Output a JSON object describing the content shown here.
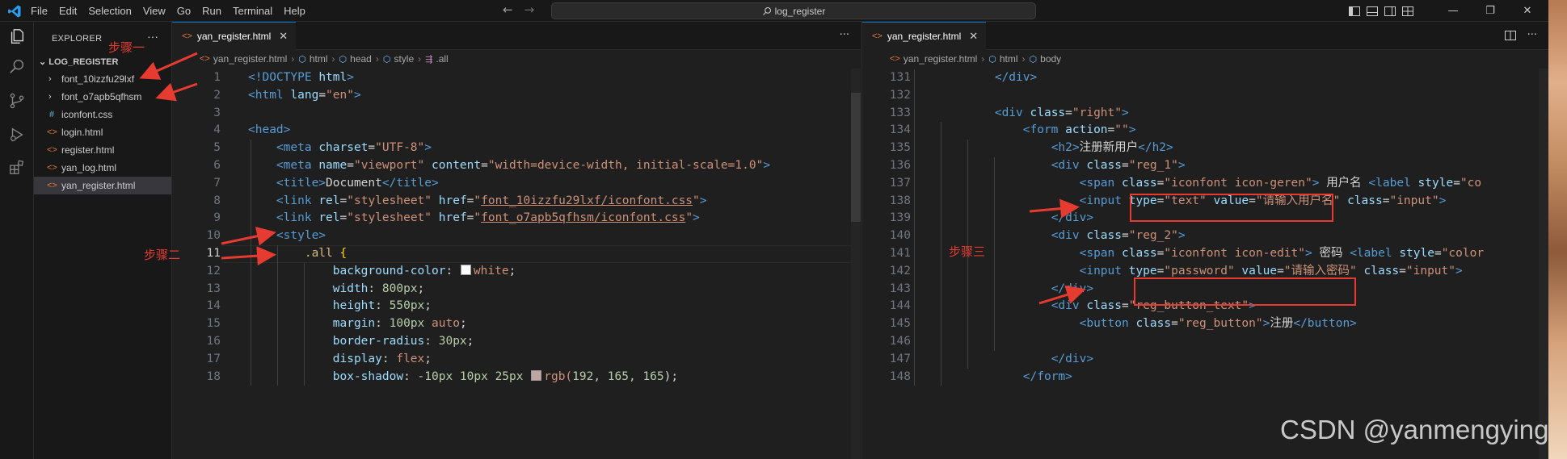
{
  "titlebar": {
    "menu": [
      "File",
      "Edit",
      "Selection",
      "View",
      "Go",
      "Run",
      "Terminal",
      "Help"
    ],
    "search_text": "log_register"
  },
  "explorer": {
    "title": "EXPLORER",
    "folder": "LOG_REGISTER",
    "items": [
      {
        "label": "font_10izzfu29lxf",
        "type": "folder"
      },
      {
        "label": "font_o7apb5qfhsm",
        "type": "folder"
      },
      {
        "label": "iconfont.css",
        "type": "css"
      },
      {
        "label": "login.html",
        "type": "html"
      },
      {
        "label": "register.html",
        "type": "html"
      },
      {
        "label": "yan_log.html",
        "type": "html"
      },
      {
        "label": "yan_register.html",
        "type": "html"
      }
    ]
  },
  "left_editor": {
    "tab_label": "yan_register.html",
    "breadcrumbs": [
      "yan_register.html",
      "html",
      "head",
      "style",
      ".all"
    ],
    "active_line": "11",
    "lines": [
      {
        "n": "1",
        "segs": [
          [
            "<!DOCTYPE ",
            "t-tag"
          ],
          [
            "html",
            "t-attr"
          ],
          [
            ">",
            "t-tag"
          ]
        ]
      },
      {
        "n": "2",
        "segs": [
          [
            "<html ",
            "t-tag"
          ],
          [
            "lang",
            "t-attr"
          ],
          [
            "=",
            ""
          ],
          [
            "\"en\"",
            "t-str"
          ],
          [
            ">",
            "t-tag"
          ]
        ]
      },
      {
        "n": "3",
        "segs": []
      },
      {
        "n": "4",
        "segs": [
          [
            "<head>",
            "t-tag"
          ]
        ]
      },
      {
        "n": "5",
        "segs": [
          [
            "    ",
            ""
          ],
          [
            "<meta ",
            "t-tag"
          ],
          [
            "charset",
            "t-attr"
          ],
          [
            "=",
            ""
          ],
          [
            "\"UTF-8\"",
            "t-str"
          ],
          [
            ">",
            "t-tag"
          ]
        ]
      },
      {
        "n": "6",
        "segs": [
          [
            "    ",
            ""
          ],
          [
            "<meta ",
            "t-tag"
          ],
          [
            "name",
            "t-attr"
          ],
          [
            "=",
            ""
          ],
          [
            "\"viewport\" ",
            "t-str"
          ],
          [
            "content",
            "t-attr"
          ],
          [
            "=",
            ""
          ],
          [
            "\"width=device-width, initial-scale=1.0\"",
            "t-str"
          ],
          [
            ">",
            "t-tag"
          ]
        ]
      },
      {
        "n": "7",
        "segs": [
          [
            "    ",
            ""
          ],
          [
            "<title>",
            "t-tag"
          ],
          [
            "Document",
            ""
          ],
          [
            "</title>",
            "t-tag"
          ]
        ]
      },
      {
        "n": "8",
        "segs": [
          [
            "    ",
            ""
          ],
          [
            "<link ",
            "t-tag"
          ],
          [
            "rel",
            "t-attr"
          ],
          [
            "=",
            ""
          ],
          [
            "\"stylesheet\" ",
            "t-str"
          ],
          [
            "href",
            "t-attr"
          ],
          [
            "=",
            ""
          ],
          [
            "\"",
            "t-str"
          ],
          [
            "font_10izzfu29lxf/iconfont.css",
            "t-link"
          ],
          [
            "\"",
            "t-str"
          ],
          [
            ">",
            "t-tag"
          ]
        ]
      },
      {
        "n": "9",
        "segs": [
          [
            "    ",
            ""
          ],
          [
            "<link ",
            "t-tag"
          ],
          [
            "rel",
            "t-attr"
          ],
          [
            "=",
            ""
          ],
          [
            "\"stylesheet\" ",
            "t-str"
          ],
          [
            "href",
            "t-attr"
          ],
          [
            "=",
            ""
          ],
          [
            "\"",
            "t-str"
          ],
          [
            "font_o7apb5qfhsm/iconfont.css",
            "t-link"
          ],
          [
            "\"",
            "t-str"
          ],
          [
            ">",
            "t-tag"
          ]
        ]
      },
      {
        "n": "10",
        "segs": [
          [
            "    ",
            ""
          ],
          [
            "<style>",
            "t-tag"
          ]
        ]
      },
      {
        "n": "11",
        "segs": [
          [
            "        ",
            ""
          ],
          [
            ".all ",
            "t-sel"
          ],
          [
            "{",
            "t-brace"
          ]
        ]
      },
      {
        "n": "12",
        "segs": [
          [
            "            ",
            ""
          ],
          [
            "background-color",
            "t-prop"
          ],
          [
            ": ",
            ""
          ],
          [
            "#SWATCH#ffffff",
            "swatch"
          ],
          [
            "white",
            "t-val"
          ],
          [
            ";",
            ""
          ]
        ]
      },
      {
        "n": "13",
        "segs": [
          [
            "            ",
            ""
          ],
          [
            "width",
            "t-prop"
          ],
          [
            ": ",
            ""
          ],
          [
            "800px",
            "t-num"
          ],
          [
            ";",
            ""
          ]
        ]
      },
      {
        "n": "14",
        "segs": [
          [
            "            ",
            ""
          ],
          [
            "height",
            "t-prop"
          ],
          [
            ": ",
            ""
          ],
          [
            "550px",
            "t-num"
          ],
          [
            ";",
            ""
          ]
        ]
      },
      {
        "n": "15",
        "segs": [
          [
            "            ",
            ""
          ],
          [
            "margin",
            "t-prop"
          ],
          [
            ": ",
            ""
          ],
          [
            "100px",
            "t-num"
          ],
          [
            " auto",
            "t-val"
          ],
          [
            ";",
            ""
          ]
        ]
      },
      {
        "n": "16",
        "segs": [
          [
            "            ",
            ""
          ],
          [
            "border-radius",
            "t-prop"
          ],
          [
            ": ",
            ""
          ],
          [
            "30px",
            "t-num"
          ],
          [
            ";",
            ""
          ]
        ]
      },
      {
        "n": "17",
        "segs": [
          [
            "            ",
            ""
          ],
          [
            "display",
            "t-prop"
          ],
          [
            ": ",
            ""
          ],
          [
            "flex",
            "t-val"
          ],
          [
            ";",
            ""
          ]
        ]
      },
      {
        "n": "18",
        "segs": [
          [
            "            ",
            ""
          ],
          [
            "box-shadow",
            "t-prop"
          ],
          [
            ": ",
            ""
          ],
          [
            "-10px 10px 25px ",
            "t-num"
          ],
          [
            "#SWATCH#c0a5a5",
            "swatch"
          ],
          [
            "rgb(",
            "t-val"
          ],
          [
            "192, 165, 165",
            "t-num"
          ],
          [
            ");",
            ""
          ]
        ]
      }
    ]
  },
  "right_editor": {
    "tab_label": "yan_register.html",
    "breadcrumbs": [
      "yan_register.html",
      "html",
      "body"
    ],
    "lines": [
      {
        "n": "131",
        "segs": [
          [
            "        ",
            ""
          ],
          [
            "</div>",
            "t-tag"
          ]
        ]
      },
      {
        "n": "132",
        "segs": []
      },
      {
        "n": "133",
        "segs": [
          [
            "        ",
            ""
          ],
          [
            "<div ",
            "t-tag"
          ],
          [
            "class",
            "t-attr"
          ],
          [
            "=",
            ""
          ],
          [
            "\"right\"",
            "t-str"
          ],
          [
            ">",
            "t-tag"
          ]
        ]
      },
      {
        "n": "134",
        "segs": [
          [
            "            ",
            ""
          ],
          [
            "<form ",
            "t-tag"
          ],
          [
            "action",
            "t-attr"
          ],
          [
            "=",
            ""
          ],
          [
            "\"\"",
            "t-str"
          ],
          [
            ">",
            "t-tag"
          ]
        ]
      },
      {
        "n": "135",
        "segs": [
          [
            "                ",
            ""
          ],
          [
            "<h2>",
            "t-tag"
          ],
          [
            "注册新用户",
            ""
          ],
          [
            "</h2>",
            "t-tag"
          ]
        ]
      },
      {
        "n": "136",
        "segs": [
          [
            "                ",
            ""
          ],
          [
            "<div ",
            "t-tag"
          ],
          [
            "class",
            "t-attr"
          ],
          [
            "=",
            ""
          ],
          [
            "\"reg_1\"",
            "t-str"
          ],
          [
            ">",
            "t-tag"
          ]
        ]
      },
      {
        "n": "137",
        "segs": [
          [
            "                    ",
            ""
          ],
          [
            "<span ",
            "t-tag"
          ],
          [
            "class",
            "t-attr"
          ],
          [
            "=",
            ""
          ],
          [
            "\"iconfont icon-geren\"",
            "t-str"
          ],
          [
            "> ",
            "t-tag"
          ],
          [
            "用户名 ",
            ""
          ],
          [
            "<label ",
            "t-tag"
          ],
          [
            "style",
            "t-attr"
          ],
          [
            "=",
            ""
          ],
          [
            "\"co",
            "t-str"
          ]
        ]
      },
      {
        "n": "138",
        "segs": [
          [
            "                    ",
            ""
          ],
          [
            "<input ",
            "t-tag"
          ],
          [
            "type",
            "t-attr"
          ],
          [
            "=",
            ""
          ],
          [
            "\"text\" ",
            "t-str"
          ],
          [
            "value",
            "t-attr"
          ],
          [
            "=",
            ""
          ],
          [
            "\"请输入用户名\" ",
            "t-str"
          ],
          [
            "class",
            "t-attr"
          ],
          [
            "=",
            ""
          ],
          [
            "\"input\"",
            "t-str"
          ],
          [
            ">",
            "t-tag"
          ]
        ]
      },
      {
        "n": "139",
        "segs": [
          [
            "                ",
            ""
          ],
          [
            "</div>",
            "t-tag"
          ]
        ]
      },
      {
        "n": "140",
        "segs": [
          [
            "                ",
            ""
          ],
          [
            "<div ",
            "t-tag"
          ],
          [
            "class",
            "t-attr"
          ],
          [
            "=",
            ""
          ],
          [
            "\"reg_2\"",
            "t-str"
          ],
          [
            ">",
            "t-tag"
          ]
        ]
      },
      {
        "n": "141",
        "segs": [
          [
            "                    ",
            ""
          ],
          [
            "<span ",
            "t-tag"
          ],
          [
            "class",
            "t-attr"
          ],
          [
            "=",
            ""
          ],
          [
            "\"iconfont icon-edit\"",
            "t-str"
          ],
          [
            "> ",
            "t-tag"
          ],
          [
            "密码 ",
            ""
          ],
          [
            "<label ",
            "t-tag"
          ],
          [
            "style",
            "t-attr"
          ],
          [
            "=",
            ""
          ],
          [
            "\"color",
            "t-str"
          ]
        ]
      },
      {
        "n": "142",
        "segs": [
          [
            "                    ",
            ""
          ],
          [
            "<input ",
            "t-tag"
          ],
          [
            "type",
            "t-attr"
          ],
          [
            "=",
            ""
          ],
          [
            "\"password\" ",
            "t-str"
          ],
          [
            "value",
            "t-attr"
          ],
          [
            "=",
            ""
          ],
          [
            "\"请输入密码\" ",
            "t-str"
          ],
          [
            "class",
            "t-attr"
          ],
          [
            "=",
            ""
          ],
          [
            "\"input\"",
            "t-str"
          ],
          [
            ">",
            "t-tag"
          ]
        ]
      },
      {
        "n": "143",
        "segs": [
          [
            "                ",
            ""
          ],
          [
            "</div>",
            "t-tag"
          ]
        ]
      },
      {
        "n": "144",
        "segs": [
          [
            "                ",
            ""
          ],
          [
            "<div ",
            "t-tag"
          ],
          [
            "class",
            "t-attr"
          ],
          [
            "=",
            ""
          ],
          [
            "\"reg_button_text\"",
            "t-str"
          ],
          [
            ">",
            "t-tag"
          ]
        ]
      },
      {
        "n": "145",
        "segs": [
          [
            "                    ",
            ""
          ],
          [
            "<button ",
            "t-tag"
          ],
          [
            "class",
            "t-attr"
          ],
          [
            "=",
            ""
          ],
          [
            "\"reg_button\"",
            "t-str"
          ],
          [
            ">",
            "t-tag"
          ],
          [
            "注册",
            ""
          ],
          [
            "</button>",
            "t-tag"
          ]
        ]
      },
      {
        "n": "146",
        "segs": []
      },
      {
        "n": "147",
        "segs": [
          [
            "                ",
            ""
          ],
          [
            "</div>",
            "t-tag"
          ]
        ]
      },
      {
        "n": "148",
        "segs": [
          [
            "            ",
            ""
          ],
          [
            "</form>",
            "t-tag"
          ]
        ]
      }
    ]
  },
  "annotations": {
    "step1": "步骤一",
    "step2": "步骤二",
    "step3": "步骤三",
    "arrow_color": "#e53b30"
  },
  "watermark": "CSDN @yanmengying",
  "colors": {
    "accent": "#0078d4",
    "editor_bg": "#1f1f1f",
    "sidebar_bg": "#181818"
  }
}
